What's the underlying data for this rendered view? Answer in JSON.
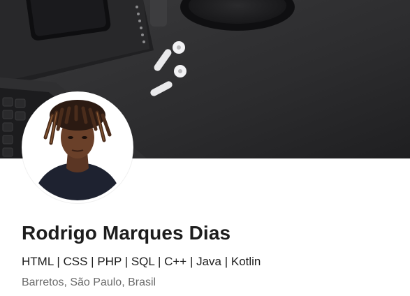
{
  "profile": {
    "name": "Rodrigo Marques Dias",
    "headline": "HTML | CSS | PHP | SQL | C++ | Java | Kotlin",
    "location": "Barretos, São Paulo, Brasil"
  },
  "colors": {
    "cover_background": "#2d2d2f",
    "name_text": "#1d1d1d",
    "location_text": "#6b6b6b"
  }
}
